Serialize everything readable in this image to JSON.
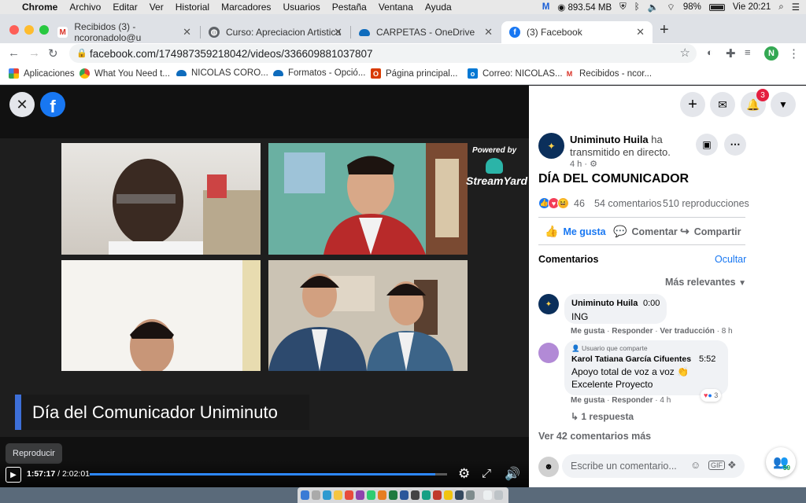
{
  "menubar": {
    "app": "Chrome",
    "items": [
      "Archivo",
      "Editar",
      "Ver",
      "Historial",
      "Marcadores",
      "Usuarios",
      "Pestaña",
      "Ventana",
      "Ayuda"
    ],
    "memory": "893.54 MB",
    "battery": "98%",
    "clock": "Vie 20:21"
  },
  "tabs": [
    {
      "label": "Recibidos (3) - ncoronadolo@u",
      "icon": "gmail-icon"
    },
    {
      "label": "Curso: Apreciacion Artistica",
      "icon": "globe-icon"
    },
    {
      "label": "CARPETAS - OneDrive",
      "icon": "onedrive-icon"
    },
    {
      "label": "(3) Facebook",
      "icon": "facebook-icon"
    }
  ],
  "toolbar": {
    "url": "facebook.com/174987359218042/videos/336609881037807",
    "profile_initial": "N"
  },
  "bookmarks": [
    {
      "label": "Aplicaciones",
      "icon": "apps-grid-icon"
    },
    {
      "label": "What You Need t...",
      "icon": "chrome-icon"
    },
    {
      "label": "NICOLAS CORO...",
      "icon": "onedrive-icon"
    },
    {
      "label": "Formatos - Opció...",
      "icon": "onedrive-icon"
    },
    {
      "label": "Página principal...",
      "icon": "office-icon"
    },
    {
      "label": "Correo: NICOLAS...",
      "icon": "outlook-icon"
    },
    {
      "label": "Recibidos - ncor...",
      "icon": "gmail-icon"
    }
  ],
  "video": {
    "powered_by": "Powered by",
    "streamyard": "StreamYard",
    "lower_third": "Día del Comunicador Uniminuto",
    "tooltip": "Reproducir",
    "time_current": "1:57:17",
    "time_total": "2:02:01",
    "progress_percent": 96.7
  },
  "fb_top": {
    "notification_count": "3"
  },
  "post": {
    "author": "Uniminuto Huila",
    "action": "ha transmitido en directo.",
    "time": "4 h",
    "title": "DÍA DEL COMUNICADOR",
    "reactions_count": "46",
    "comments_count": "54 comentarios",
    "views_count": "510 reproducciones",
    "like_label": "Me gusta",
    "comment_label": "Comentar",
    "share_label": "Compartir",
    "comments_heading": "Comentarios",
    "hide_label": "Ocultar",
    "sort_label": "Más relevantes",
    "comments": [
      {
        "author": "Uniminuto Huila",
        "inline_time": "0:00",
        "text": "ING",
        "actions": [
          "Me gusta",
          "Responder",
          "Ver traducción"
        ],
        "age": "8 h"
      },
      {
        "badge": "Usuario que comparte",
        "author": "Karol Tatiana García Cifuentes",
        "inline_time": "5:52",
        "text_line1": "Apoyo total de voz a voz 👏",
        "text_line2": "Excelente Proyecto",
        "reaction_count": "3",
        "actions": [
          "Me gusta",
          "Responder"
        ],
        "age": "4 h",
        "replies": "1 respuesta"
      }
    ],
    "more_comments": "Ver 42 comentarios más",
    "composer_placeholder": "Escribe un comentario...",
    "viewers_count": "59"
  }
}
